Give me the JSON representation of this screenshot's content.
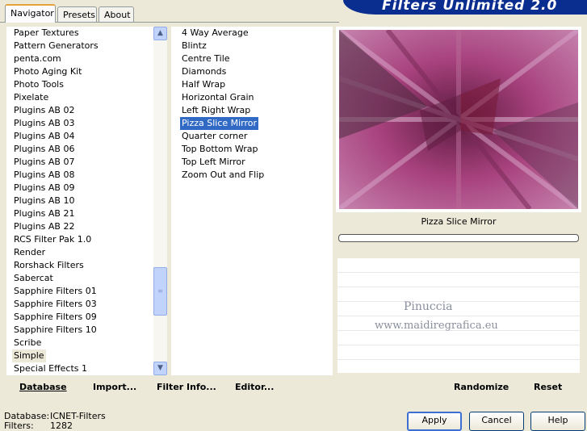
{
  "tabs": [
    {
      "label": "Navigator"
    },
    {
      "label": "Presets"
    },
    {
      "label": "About"
    }
  ],
  "app_title": "Filters Unlimited 2.0",
  "categories": [
    "Paper Textures",
    "Pattern Generators",
    "penta.com",
    "Photo Aging Kit",
    "Photo Tools",
    "Pixelate",
    "Plugins AB 02",
    "Plugins AB 03",
    "Plugins AB 04",
    "Plugins AB 06",
    "Plugins AB 07",
    "Plugins AB 08",
    "Plugins AB 09",
    "Plugins AB 10",
    "Plugins AB 21",
    "Plugins AB 22",
    "RCS Filter Pak 1.0",
    "Render",
    "Rorshack Filters",
    "Sabercat",
    "Sapphire Filters 01",
    "Sapphire Filters 03",
    "Sapphire Filters 09",
    "Sapphire Filters 10",
    "Scribe",
    "Simple",
    "Special Effects 1"
  ],
  "current_category": "Simple",
  "filters": [
    "4 Way Average",
    "Blintz",
    "Centre Tile",
    "Diamonds",
    "Half Wrap",
    "Horizontal Grain",
    "Left Right Wrap",
    "Pizza Slice Mirror",
    "Quarter corner",
    "Top Bottom Wrap",
    "Top Left Mirror",
    "Zoom Out and Flip"
  ],
  "selected_filter": "Pizza Slice Mirror",
  "preview": {
    "filter_name": "Pizza Slice Mirror",
    "progress": 0
  },
  "watermark": {
    "line1": "Pinuccia",
    "line2": "www.maidiregrafica.eu"
  },
  "toolbar": {
    "database": "Database",
    "import": "Import...",
    "filter_info": "Filter Info...",
    "editor": "Editor...",
    "randomize": "Randomize",
    "reset": "Reset"
  },
  "status": {
    "database_label": "Database:",
    "database_value": "ICNET-Filters",
    "filters_label": "Filters:",
    "filters_value": "1282"
  },
  "buttons": {
    "apply": "Apply",
    "cancel": "Cancel",
    "help": "Help"
  },
  "colors": {
    "selection": "#316ac5",
    "banner": "#0a2e8f",
    "preview_base": "#8e2f66"
  },
  "icons": {
    "scroll_up": "▲",
    "scroll_down": "▼",
    "thumb_grip": "≡"
  }
}
